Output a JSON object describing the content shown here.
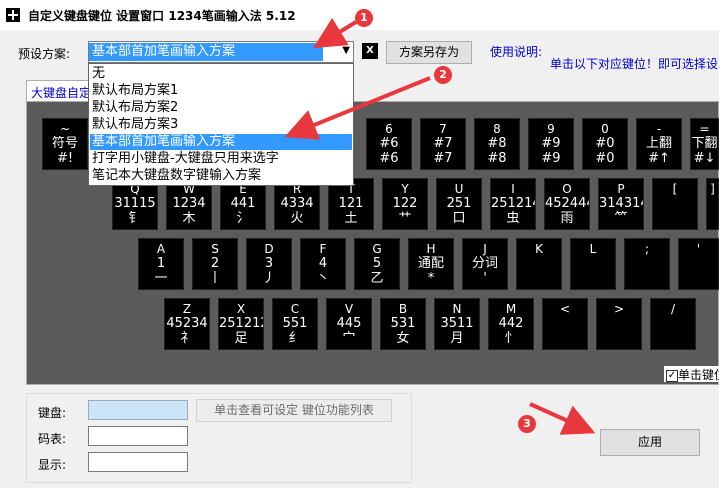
{
  "window": {
    "title": "自定义键盘键位  设置窗口  1234笔画输入法 5.12"
  },
  "preset": {
    "label": "预设方案:",
    "selected": "基本部首加笔画输入方案",
    "options": [
      "无",
      "默认布局方案1",
      "默认布局方案2",
      "默认布局方案3",
      "基本部首加笔画输入方案",
      "打字用小键盘-大键盘只用来选字",
      "笔记本大键盘数字键输入方案"
    ],
    "clear_label": "X",
    "save_as_label": "方案另存为"
  },
  "help": {
    "label": "使用说明:",
    "text": "单击以下对应键位！即可选择设"
  },
  "tab_label": "大键盘自定",
  "keyboard": {
    "row1": [
      {
        "l1": "~",
        "l2": "符号",
        "l3": "#!"
      },
      {
        "l1": "6",
        "l2": "#6",
        "l3": "#6"
      },
      {
        "l1": "7",
        "l2": "#7",
        "l3": "#7"
      },
      {
        "l1": "8",
        "l2": "#8",
        "l3": "#8"
      },
      {
        "l1": "9",
        "l2": "#9",
        "l3": "#9"
      },
      {
        "l1": "0",
        "l2": "#0",
        "l3": "#0"
      },
      {
        "l1": "-",
        "l2": "上翻",
        "l3": "#↑"
      },
      {
        "l1": "=",
        "l2": "下翻",
        "l3": "#↓"
      }
    ],
    "row2": [
      {
        "l1": "Q",
        "l2": "31115",
        "l3": "钅"
      },
      {
        "l1": "W",
        "l2": "1234",
        "l3": "木"
      },
      {
        "l1": "E",
        "l2": "441",
        "l3": "氵"
      },
      {
        "l1": "R",
        "l2": "4334",
        "l3": "火"
      },
      {
        "l1": "T",
        "l2": "121",
        "l3": "土"
      },
      {
        "l1": "Y",
        "l2": "122",
        "l3": "艹"
      },
      {
        "l1": "U",
        "l2": "251",
        "l3": "口"
      },
      {
        "l1": "I",
        "l2": "251214",
        "l3": "虫"
      },
      {
        "l1": "O",
        "l2": "452444",
        "l3": "雨"
      },
      {
        "l1": "P",
        "l2": "314314",
        "l3": "⺮"
      },
      {
        "l1": "[",
        "l2": "",
        "l3": ""
      },
      {
        "l1": "]",
        "l2": "",
        "l3": ""
      }
    ],
    "row3": [
      {
        "l1": "A",
        "l2": "1",
        "l3": "一"
      },
      {
        "l1": "S",
        "l2": "2",
        "l3": "丨"
      },
      {
        "l1": "D",
        "l2": "3",
        "l3": "丿"
      },
      {
        "l1": "F",
        "l2": "4",
        "l3": "丶"
      },
      {
        "l1": "G",
        "l2": "5",
        "l3": "乙"
      },
      {
        "l1": "H",
        "l2": "通配",
        "l3": "*"
      },
      {
        "l1": "J",
        "l2": "分词",
        "l3": "'"
      },
      {
        "l1": "K",
        "l2": "",
        "l3": ""
      },
      {
        "l1": "L",
        "l2": "",
        "l3": ""
      },
      {
        "l1": ";",
        "l2": "",
        "l3": ""
      },
      {
        "l1": "'",
        "l2": "",
        "l3": ""
      }
    ],
    "row4": [
      {
        "l1": "Z",
        "l2": "45234",
        "l3": "礻"
      },
      {
        "l1": "X",
        "l2": "2512121",
        "l3": "足"
      },
      {
        "l1": "C",
        "l2": "551",
        "l3": "纟"
      },
      {
        "l1": "V",
        "l2": "445",
        "l3": "宀"
      },
      {
        "l1": "B",
        "l2": "531",
        "l3": "女"
      },
      {
        "l1": "N",
        "l2": "3511",
        "l3": "月"
      },
      {
        "l1": "M",
        "l2": "442",
        "l3": "忄"
      },
      {
        "l1": "<",
        "l2": "",
        "l3": ""
      },
      {
        "l1": ">",
        "l2": "",
        "l3": ""
      },
      {
        "l1": "/",
        "l2": "",
        "l3": ""
      }
    ]
  },
  "checkbox": {
    "label": "单击键位",
    "checked": true
  },
  "bottom": {
    "key_label": "键盘:",
    "code_label": "码表:",
    "display_label": "显示:",
    "hint_label": "单击查看可设定 键位功能列表",
    "apply_label": "应用"
  },
  "annotations": [
    "1",
    "2",
    "3"
  ],
  "colors": {
    "accent": "#3399ff",
    "annotation": "#e8383d",
    "link": "#0000cc"
  }
}
